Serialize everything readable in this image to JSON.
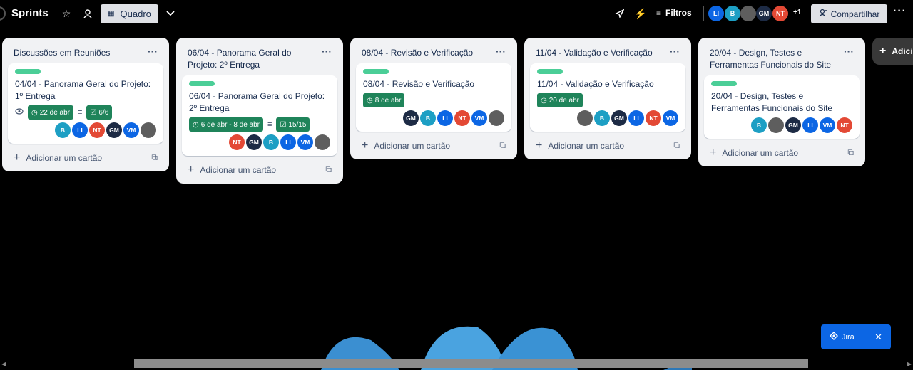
{
  "header": {
    "board_title": "Sprints",
    "view_label": "Quadro",
    "filters_label": "Filtros",
    "share_label": "Compartilhar",
    "more_members": "+1",
    "members": [
      {
        "initials": "LI",
        "color": "#0c66e4"
      },
      {
        "initials": "B",
        "color": "#1d9fc4"
      },
      {
        "initials": "",
        "color": "#5e5e5e"
      },
      {
        "initials": "GM",
        "color": "#1d2b45"
      },
      {
        "initials": "NT",
        "color": "#e34935"
      }
    ]
  },
  "lists": [
    {
      "title": "Discussões em Reuniões",
      "add_card": "Adicionar um cartão",
      "card": {
        "title": "04/04 - Panorama Geral do Projeto: 1º Entrega",
        "due": "22 de abr",
        "checklist": "6/6"
      }
    },
    {
      "title": "06/04 - Panorama Geral do Projeto: 2º Entrega",
      "add_card": "Adicionar um cartão",
      "card": {
        "title": "06/04 - Panorama Geral do Projeto: 2º Entrega",
        "due": "6 de abr - 8 de abr",
        "checklist": "15/15"
      }
    },
    {
      "title": "08/04 - Revisão e Verificação",
      "add_card": "Adicionar um cartão",
      "card": {
        "title": "08/04 - Revisão e Verificação",
        "due": "8 de abr"
      }
    },
    {
      "title": "11/04 - Validação e Verificação",
      "add_card": "Adicionar um cartão",
      "card": {
        "title": "11/04 - Validação e Verificação",
        "due": "20 de abr"
      }
    },
    {
      "title": "20/04 - Design, Testes e Ferramentas Funcionais do Site",
      "add_card": "Adicionar um cartão",
      "card": {
        "title": "20/04 - Design, Testes e Ferramentas Funcionais do Site"
      }
    }
  ],
  "add_list_label": "Adici",
  "jira_label": "Jira",
  "colors": {
    "label_green": "#4bce97",
    "badge_green": "#1f845a",
    "member_b": "#1d9fc4",
    "member_li": "#0c66e4",
    "member_nt": "#e34935",
    "member_gm": "#1d2b45",
    "member_vm": "#0c66e4",
    "jira_blue": "#0c66e4"
  }
}
